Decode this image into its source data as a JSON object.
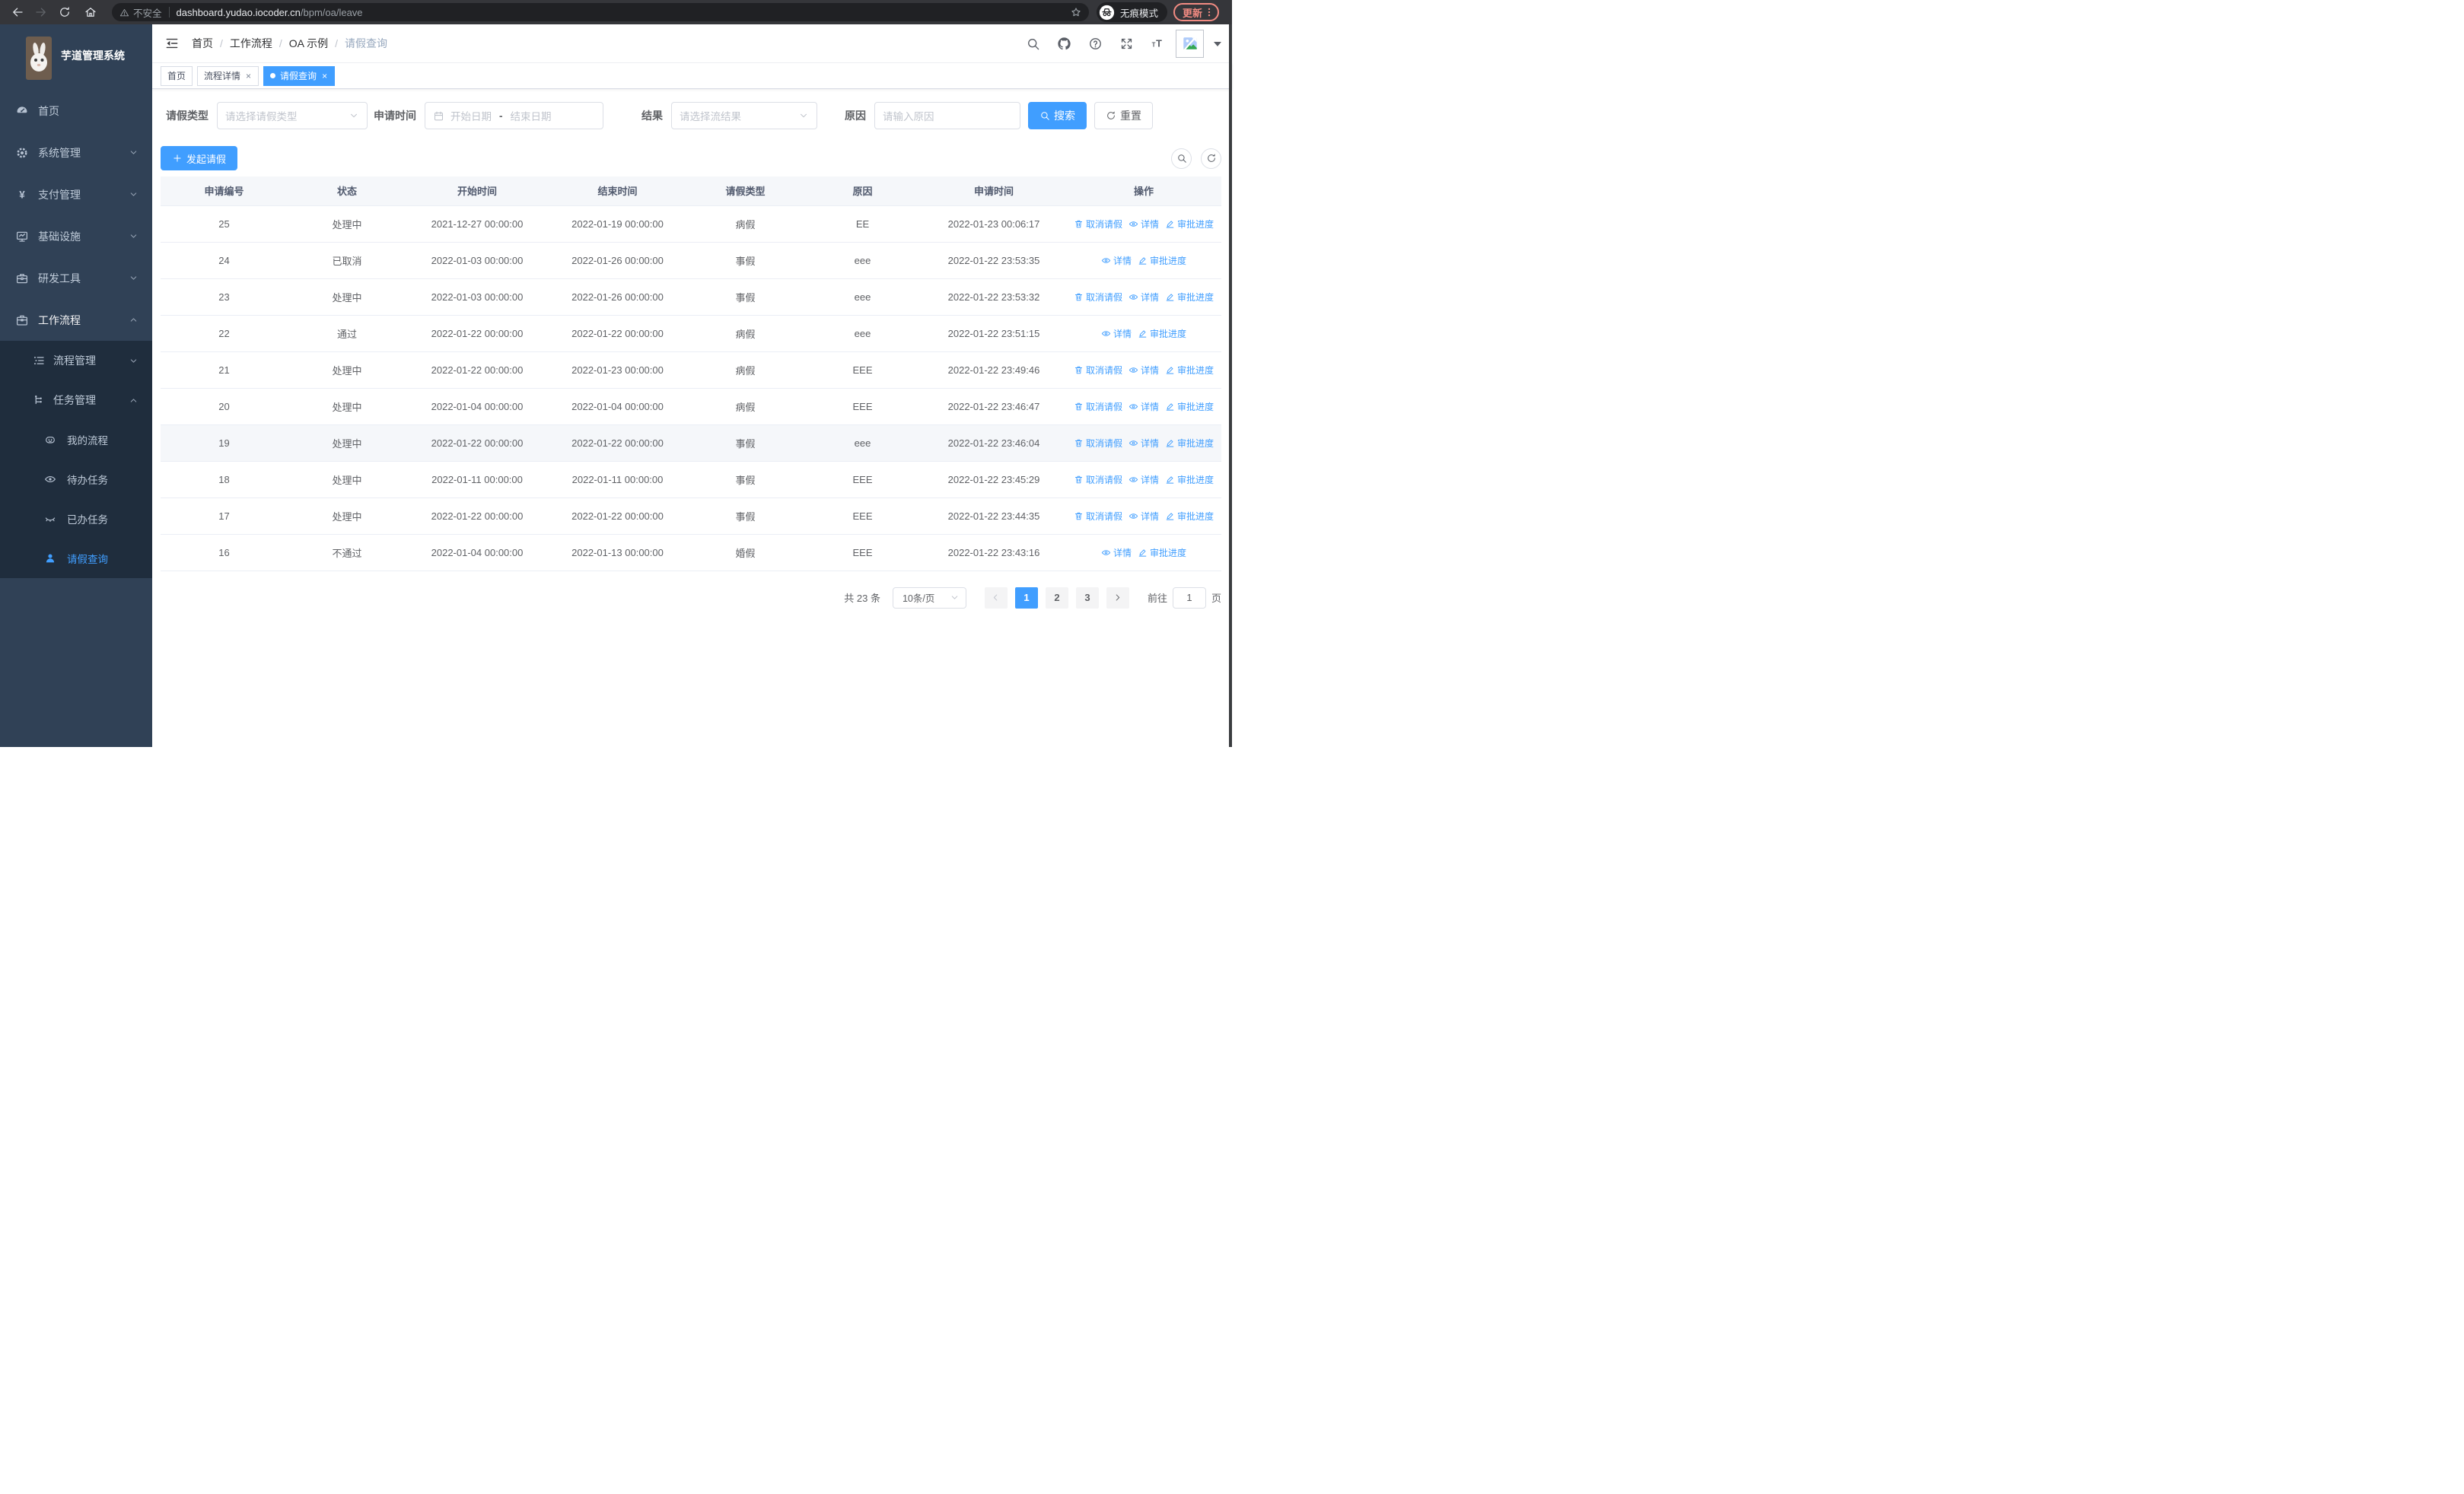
{
  "browser": {
    "security_label": "不安全",
    "url_host": "dashboard.yudao.iocoder.cn",
    "url_path": "/bpm/oa/leave",
    "incognito_label": "无痕模式",
    "update_label": "更新",
    "accent_color": "#f28b82"
  },
  "sidebar": {
    "title": "芋道管理系统",
    "menu": [
      {
        "label": "首页",
        "icon": "dashboard-icon",
        "level": 1
      },
      {
        "label": "系统管理",
        "icon": "gear-icon",
        "level": 1,
        "chevron": "down"
      },
      {
        "label": "支付管理",
        "icon": "yen-icon",
        "level": 1,
        "chevron": "down"
      },
      {
        "label": "基础设施",
        "icon": "monitor-icon",
        "level": 1,
        "chevron": "down"
      },
      {
        "label": "研发工具",
        "icon": "toolbox-icon",
        "level": 1,
        "chevron": "down"
      },
      {
        "label": "工作流程",
        "icon": "briefcase-icon",
        "level": 1,
        "chevron": "up",
        "trail": true
      },
      {
        "label": "流程管理",
        "icon": "list-icon",
        "level": 2,
        "chevron": "down",
        "sub": true
      },
      {
        "label": "任务管理",
        "icon": "tree-icon",
        "level": 2,
        "chevron": "up",
        "sub": true
      },
      {
        "label": "我的流程",
        "icon": "robot-icon",
        "level": 3,
        "sub": true
      },
      {
        "label": "待办任务",
        "icon": "eye-open-icon",
        "level": 3,
        "sub": true
      },
      {
        "label": "已办任务",
        "icon": "eye-closed-icon",
        "level": 3,
        "sub": true
      },
      {
        "label": "请假查询",
        "icon": "user-icon",
        "level": 3,
        "sub": true,
        "active": true
      }
    ]
  },
  "navbar": {
    "breadcrumb": [
      "首页",
      "工作流程",
      "OA 示例",
      "请假查询"
    ],
    "right_icons": [
      "search-icon",
      "github-icon",
      "help-icon",
      "fullscreen-icon",
      "font-size-icon"
    ]
  },
  "tabs": [
    {
      "label": "首页",
      "closable": false,
      "active": false
    },
    {
      "label": "流程详情",
      "closable": true,
      "active": false
    },
    {
      "label": "请假查询",
      "closable": true,
      "active": true
    }
  ],
  "filters": {
    "leave_type_label": "请假类型",
    "leave_type_placeholder": "请选择请假类型",
    "apply_time_label": "申请时间",
    "start_date_placeholder": "开始日期",
    "range_separator": "-",
    "end_date_placeholder": "结束日期",
    "result_label": "结果",
    "result_placeholder": "请选择流结果",
    "reason_label": "原因",
    "reason_placeholder": "请输入原因",
    "search_label": "搜索",
    "reset_label": "重置"
  },
  "toolbar": {
    "create_label": "发起请假"
  },
  "table": {
    "columns": [
      "申请编号",
      "状态",
      "开始时间",
      "结束时间",
      "请假类型",
      "原因",
      "申请时间",
      "操作"
    ],
    "action_labels": {
      "cancel": "取消请假",
      "detail": "详情",
      "progress": "审批进度"
    },
    "rows": [
      {
        "id": "25",
        "status": "处理中",
        "start": "2021-12-27 00:00:00",
        "end": "2022-01-19 00:00:00",
        "type": "病假",
        "reason": "EE",
        "apply_time": "2022-01-23 00:06:17",
        "actions": [
          "cancel",
          "detail",
          "progress"
        ]
      },
      {
        "id": "24",
        "status": "已取消",
        "start": "2022-01-03 00:00:00",
        "end": "2022-01-26 00:00:00",
        "type": "事假",
        "reason": "eee",
        "apply_time": "2022-01-22 23:53:35",
        "actions": [
          "detail",
          "progress"
        ]
      },
      {
        "id": "23",
        "status": "处理中",
        "start": "2022-01-03 00:00:00",
        "end": "2022-01-26 00:00:00",
        "type": "事假",
        "reason": "eee",
        "apply_time": "2022-01-22 23:53:32",
        "actions": [
          "cancel",
          "detail",
          "progress"
        ]
      },
      {
        "id": "22",
        "status": "通过",
        "start": "2022-01-22 00:00:00",
        "end": "2022-01-22 00:00:00",
        "type": "病假",
        "reason": "eee",
        "apply_time": "2022-01-22 23:51:15",
        "actions": [
          "detail",
          "progress"
        ]
      },
      {
        "id": "21",
        "status": "处理中",
        "start": "2022-01-22 00:00:00",
        "end": "2022-01-23 00:00:00",
        "type": "病假",
        "reason": "EEE",
        "apply_time": "2022-01-22 23:49:46",
        "actions": [
          "cancel",
          "detail",
          "progress"
        ]
      },
      {
        "id": "20",
        "status": "处理中",
        "start": "2022-01-04 00:00:00",
        "end": "2022-01-04 00:00:00",
        "type": "病假",
        "reason": "EEE",
        "apply_time": "2022-01-22 23:46:47",
        "actions": [
          "cancel",
          "detail",
          "progress"
        ]
      },
      {
        "id": "19",
        "status": "处理中",
        "start": "2022-01-22 00:00:00",
        "end": "2022-01-22 00:00:00",
        "type": "事假",
        "reason": "eee",
        "apply_time": "2022-01-22 23:46:04",
        "actions": [
          "cancel",
          "detail",
          "progress"
        ],
        "highlighted": true
      },
      {
        "id": "18",
        "status": "处理中",
        "start": "2022-01-11 00:00:00",
        "end": "2022-01-11 00:00:00",
        "type": "事假",
        "reason": "EEE",
        "apply_time": "2022-01-22 23:45:29",
        "actions": [
          "cancel",
          "detail",
          "progress"
        ]
      },
      {
        "id": "17",
        "status": "处理中",
        "start": "2022-01-22 00:00:00",
        "end": "2022-01-22 00:00:00",
        "type": "事假",
        "reason": "EEE",
        "apply_time": "2022-01-22 23:44:35",
        "actions": [
          "cancel",
          "detail",
          "progress"
        ]
      },
      {
        "id": "16",
        "status": "不通过",
        "start": "2022-01-04 00:00:00",
        "end": "2022-01-13 00:00:00",
        "type": "婚假",
        "reason": "EEE",
        "apply_time": "2022-01-22 23:43:16",
        "actions": [
          "detail",
          "progress"
        ]
      }
    ]
  },
  "pagination": {
    "total_text": "共 23 条",
    "page_size": "10条/页",
    "pages": [
      "1",
      "2",
      "3"
    ],
    "active_page": "1",
    "goto_label": "前往",
    "goto_value": "1",
    "page_unit": "页"
  },
  "colors": {
    "primary": "#409eff",
    "sidebar_bg": "#304156",
    "submenu_bg": "#1f2d3d"
  }
}
